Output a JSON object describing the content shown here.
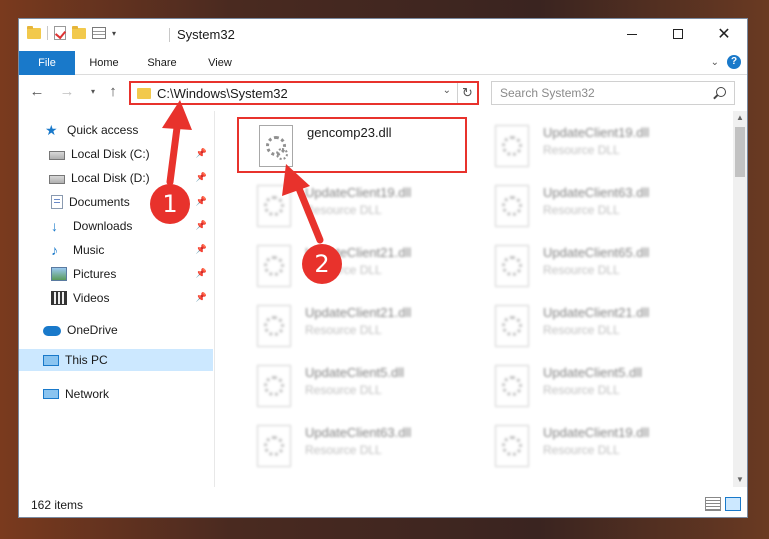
{
  "window": {
    "title": "System32"
  },
  "window_controls": {
    "minimize": "–",
    "maximize": "□",
    "close": "✕"
  },
  "ribbon": {
    "tabs": [
      {
        "label": "File"
      },
      {
        "label": "Home"
      },
      {
        "label": "Share"
      },
      {
        "label": "View"
      }
    ],
    "help": "?"
  },
  "navigation": {
    "back": "←",
    "forward": "→",
    "recent": "▾",
    "up": "↑"
  },
  "address_bar": {
    "path": "C:\\Windows\\System32",
    "dropdown": "⌄",
    "refresh": "↻"
  },
  "search": {
    "placeholder": "Search System32"
  },
  "sidebar": {
    "items": [
      {
        "label": "Quick access",
        "icon": "star-icon"
      },
      {
        "label": "Local Disk (C:)",
        "icon": "drive-icon",
        "pinned": true
      },
      {
        "label": "Local Disk (D:)",
        "icon": "drive-icon",
        "pinned": true
      },
      {
        "label": "Documents",
        "icon": "documents-icon",
        "pinned": true
      },
      {
        "label": "Downloads",
        "icon": "downloads-icon",
        "pinned": true
      },
      {
        "label": "Music",
        "icon": "music-icon",
        "pinned": true
      },
      {
        "label": "Pictures",
        "icon": "pictures-icon",
        "pinned": true
      },
      {
        "label": "Videos",
        "icon": "videos-icon",
        "pinned": true
      },
      {
        "label": "OneDrive",
        "icon": "onedrive-icon"
      },
      {
        "label": "This PC",
        "icon": "computer-icon",
        "selected": true
      },
      {
        "label": "Network",
        "icon": "network-icon"
      }
    ]
  },
  "files": [
    {
      "name": "gencomp23.dll",
      "type": "",
      "highlighted": true
    },
    {
      "name": "UpdateClient19.dll",
      "type": "Resource DLL"
    },
    {
      "name": "UpdateClient19.dll",
      "type": "Resource DLL"
    },
    {
      "name": "UpdateClient63.dll",
      "type": "Resource DLL"
    },
    {
      "name": "UpdateClient21.dll",
      "type": "Resource DLL"
    },
    {
      "name": "UpdateClient65.dll",
      "type": "Resource DLL"
    },
    {
      "name": "UpdateClient21.dll",
      "type": "Resource DLL"
    },
    {
      "name": "UpdateClient21.dll",
      "type": "Resource DLL"
    },
    {
      "name": "UpdateClient5.dll",
      "type": "Resource DLL"
    },
    {
      "name": "UpdateClient5.dll",
      "type": "Resource DLL"
    },
    {
      "name": "UpdateClient63.dll",
      "type": "Resource DLL"
    },
    {
      "name": "UpdateClient19.dll",
      "type": "Resource DLL"
    }
  ],
  "status": {
    "item_count": "162 items"
  },
  "annotations": {
    "step1": "1",
    "step2": "2",
    "color": "#e8322c"
  },
  "colors": {
    "accent": "#1979ca",
    "highlight": "#e8322c",
    "selection": "#cce8ff"
  }
}
